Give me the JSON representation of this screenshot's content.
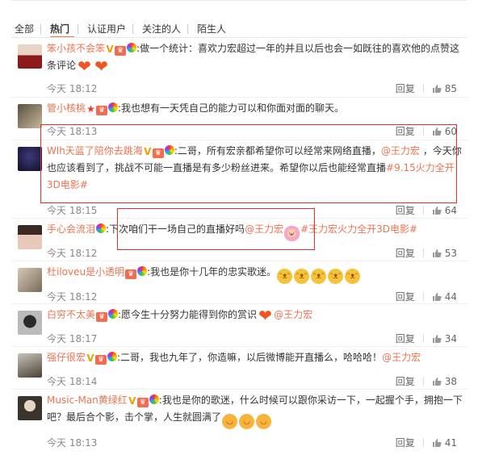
{
  "tabs": [
    {
      "label": "全部",
      "active": false
    },
    {
      "label": "热门",
      "active": true
    },
    {
      "label": "认证用户",
      "active": false
    },
    {
      "label": "关注的人",
      "active": false
    },
    {
      "label": "陌生人",
      "active": false
    }
  ],
  "comments": [
    {
      "nick": "笨小孩不会笨",
      "badges": [
        "vip-v-icon",
        "crown-icon",
        "rainbow-icon"
      ],
      "text_parts": [
        ":做一个统计：喜欢力宏超过一年的并且以后也会一如既往的喜欢他的点赞这条评论"
      ],
      "emoticons": [
        "heart",
        "heart"
      ],
      "time": "今天 18:12",
      "reply_label": "回复",
      "likes": "85"
    },
    {
      "nick": "管小核桃",
      "badges": [
        "star-icon",
        "crown-icon",
        "rainbow-icon"
      ],
      "text_parts": [
        ":我也想有一天凭自己的能力可以和你面对面的聊天。"
      ],
      "time": "今天 18:13",
      "reply_label": "回复",
      "likes": "60"
    },
    {
      "nick": "Wlh天蓝了陪你去跳海",
      "badges": [
        "vip-v-icon",
        "crown-icon",
        "rainbow-icon"
      ],
      "text_parts": [
        ":二哥，所有宏亲都希望你可以经常来网络直播，",
        "@王力宏",
        " ，今天你也应该看到了，挑战不可能一直播是有多少粉丝进来。希望你以后也能经常直播",
        "#9.15火力全开3D电影#"
      ],
      "time": "今天 18:15",
      "reply_label": "回复",
      "likes": "64"
    },
    {
      "nick": "手心会流泪",
      "badges": [
        "rainbow-icon"
      ],
      "text_parts": [
        ":下次咱们干一场自己的直播好吗",
        "@王力宏",
        "#王力宏火力全开3D电影#"
      ],
      "time": "今天 18:12",
      "reply_label": "回复",
      "likes": "53"
    },
    {
      "nick": "杜iloveu是小透明",
      "badges": [
        "crown-icon",
        "rainbow-icon"
      ],
      "text_parts": [
        ":我也是你十几年的忠实歌迷。"
      ],
      "emoticons": [
        "face",
        "face",
        "face",
        "face",
        "face"
      ],
      "time": "今天 18:12",
      "reply_label": "回复",
      "likes": "44"
    },
    {
      "nick": "白穷不太美",
      "badges": [
        "crown-icon",
        "rainbow-icon"
      ],
      "text_parts": [
        ":愿今生十分努力能得到你的赏识",
        "@王力宏"
      ],
      "time": "今天 18:17",
      "reply_label": "回复",
      "likes": "34"
    },
    {
      "nick": "强仔很宏",
      "badges": [
        "vip-v-icon",
        "crown-icon",
        "rainbow-icon"
      ],
      "text_parts": [
        ":二哥，我也九年了，你造嘛，以后微博能开直播么，哈哈哈！",
        "@王力宏"
      ],
      "time": "今天 18:14",
      "reply_label": "回复",
      "likes": "38"
    },
    {
      "nick": "Music-Man黄绿红",
      "badges": [
        "vip-v-icon",
        "crown-icon",
        "rainbow-icon"
      ],
      "text_parts": [
        ":我也是你的歌迷，什么时候可以跟你采访一下，一起握个手，拥抱一下吧？最后合个影，击个掌，人生就圆满了"
      ],
      "emoticons": [
        "blush",
        "blush",
        "blush"
      ],
      "time": "今天 18:13",
      "reply_label": "回复",
      "likes": "41"
    }
  ],
  "colors": {
    "nickname": "#eb7350",
    "highlight_box": "#d9352e",
    "tab_indicator": "#fa7d3c",
    "meta": "#888888"
  }
}
